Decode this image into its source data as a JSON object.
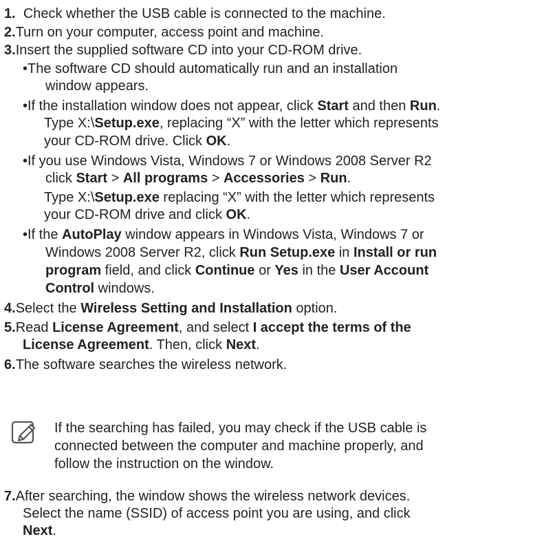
{
  "steps": [
    {
      "num": "1.",
      "text": "Check whether the USB cable is connected to the machine."
    },
    {
      "num": "2.",
      "text": "Turn on your computer, access point and machine."
    },
    {
      "num": "3.",
      "text": "Insert the supplied software CD into your CD-ROM drive."
    },
    {
      "num": "4.",
      "pre": "Select the ",
      "b1": "Wireless Setting and Installation",
      "post": " option."
    },
    {
      "num": "5.",
      "pre": "Read ",
      "b1": "License Agreement",
      "mid": ", and select ",
      "b2": "I accept the terms of the",
      "b3": "License Agreement",
      "mid2": ". Then, click ",
      "b4": "Next",
      "post": "."
    },
    {
      "num": "6.",
      "text": "The software searches the wireless network."
    },
    {
      "num": "7.",
      "line1": "After searching, the window shows the wireless network devices.",
      "line2": "Select the name (SSID) of access point you are using, and click",
      "b1": "Next",
      "post": "."
    }
  ],
  "bullets": [
    {
      "line1": "•The software CD should automatically run and an installation",
      "line2": "window appears."
    },
    {
      "l1_pre": "•If the installation window does not appear, click ",
      "start": "Start",
      "and_then": " and then ",
      "run": "Run",
      "dot": ".",
      "l2_pre": "Type X:\\",
      "setup": "Setup.exe",
      "l2_post": ", replacing “X” with the letter which represents",
      "l3_pre": "your CD-ROM drive. Click ",
      "ok": "OK",
      "l3_post": "."
    },
    {
      "line1": "•If you use Windows Vista, Windows 7 or Windows 2008 Server R2",
      "l2_pre": "click ",
      "start": "Start",
      "sep": " > ",
      "all_programs": "All programs",
      "accessories": "Accessories",
      "run": "Run",
      "dot": ".",
      "l3_pre": "Type X:\\",
      "setup": "Setup.exe",
      "l3_post": " replacing “X” with the letter which represents",
      "l4_pre": "your CD-ROM drive and click ",
      "ok": "OK",
      "l4_post": "."
    },
    {
      "l1_pre": "•If the ",
      "autoplay": "AutoPlay",
      "l1_post": " window appears in Windows Vista, Windows 7 or",
      "l2_pre": "Windows 2008 Server R2, click ",
      "run_setup": "Run Setup.exe",
      "in": " in ",
      "install_or_run": "Install or run",
      "program": "program",
      "l3_mid": " field, and click ",
      "continue": "Continue",
      "or": " or ",
      "yes": "Yes",
      "in_the": " in the ",
      "user_account": "User Account",
      "control": "Control",
      "l4_post": " windows."
    }
  ],
  "note": {
    "icon": "note-pencil-icon",
    "line1": "If the searching has failed, you may check if the USB cable is",
    "line2": "connected between the computer and machine properly, and",
    "line3": "follow the instruction on the window."
  },
  "colors": {
    "text": "#222222",
    "icon": "#555555"
  }
}
